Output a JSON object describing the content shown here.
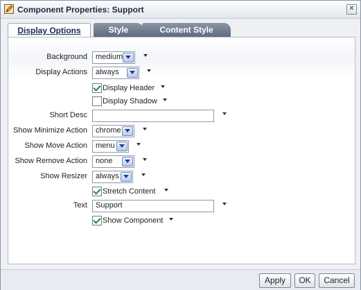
{
  "window": {
    "title": "Component Properties: Support",
    "close_glyph": "✕",
    "icon": "pencil-edit-icon"
  },
  "tabs": [
    {
      "label": "Display Options",
      "active": true
    },
    {
      "label": "Style",
      "active": false
    },
    {
      "label": "Content Style",
      "active": false
    }
  ],
  "fields": {
    "background": {
      "label": "Background",
      "value": "medium"
    },
    "display_actions": {
      "label": "Display Actions",
      "value": "always"
    },
    "display_header": {
      "label": "Display Header",
      "checked": true
    },
    "display_shadow": {
      "label": "Display Shadow",
      "checked": false
    },
    "short_desc": {
      "label": "Short Desc",
      "value": ""
    },
    "show_minimize_action": {
      "label": "Show Minimize Action",
      "value": "chrome"
    },
    "show_move_action": {
      "label": "Show Move Action",
      "value": "menu"
    },
    "show_remove_action": {
      "label": "Show Remove Action",
      "value": "none"
    },
    "show_resizer": {
      "label": "Show Resizer",
      "value": "always"
    },
    "stretch_content": {
      "label": "Stretch Content",
      "checked": true
    },
    "text": {
      "label": "Text",
      "value": "Support"
    },
    "show_component": {
      "label": "Show Component",
      "checked": true
    }
  },
  "buttons": {
    "apply": "Apply",
    "ok": "OK",
    "cancel": "Cancel"
  },
  "colors": {
    "tab_active_text": "#1a2a55",
    "check_mark": "#1a8a2a"
  }
}
